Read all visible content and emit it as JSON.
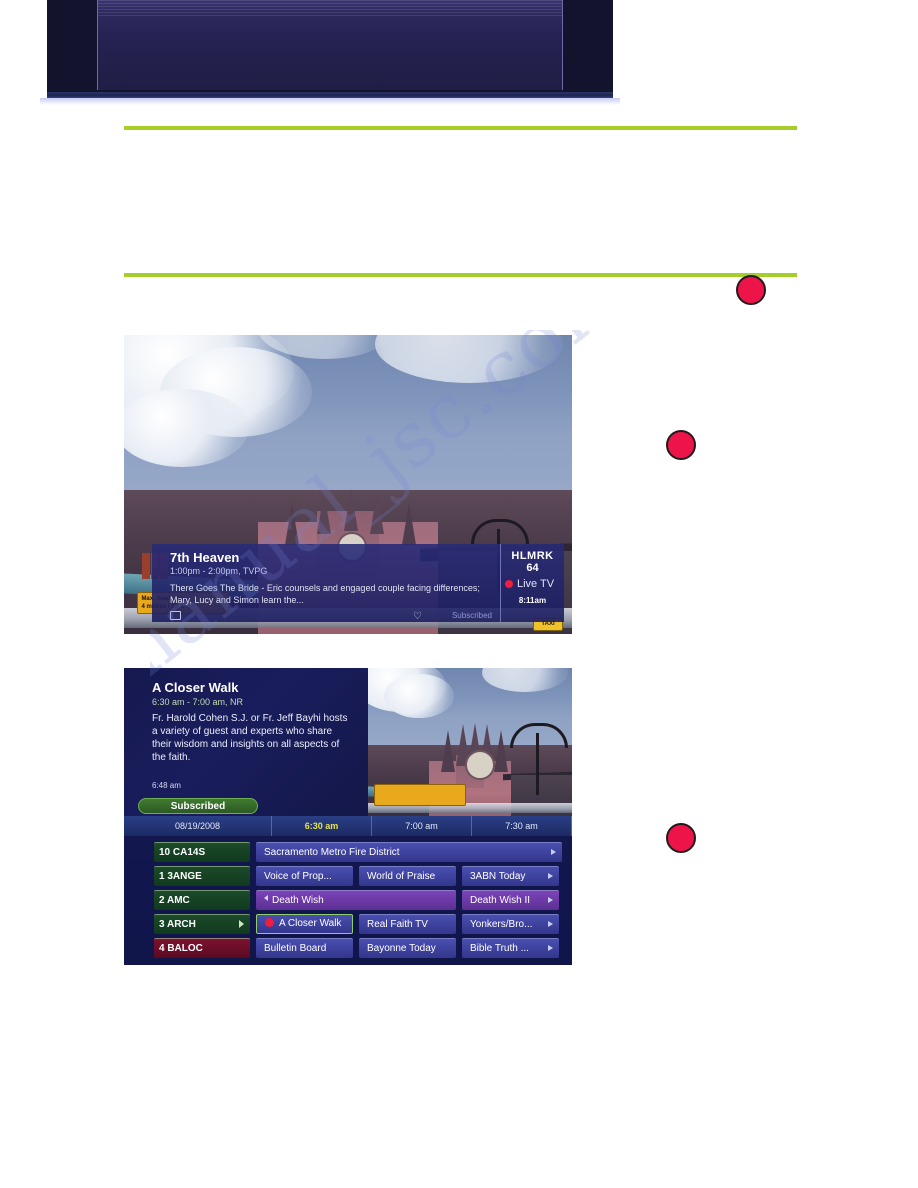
{
  "page": {
    "background_color": "#ffffff",
    "accent_green": "#a5ce2b",
    "marker_color": "#ec1448",
    "watermark_text": "manual_jsc.com"
  },
  "top_banner": {
    "name": "document-header-banner",
    "title": "",
    "background_color": "#14132e"
  },
  "markers": [
    {
      "id": "marker-1",
      "label": ""
    },
    {
      "id": "marker-2",
      "label": ""
    },
    {
      "id": "marker-3",
      "label": ""
    }
  ],
  "figure_one": {
    "name": "live-tv-info-banner-screenshot",
    "photo_alt": "Bristol Temple Meads railway station",
    "photo_signs": {
      "height_sign_line1": "Max. headroom",
      "height_sign_line2": "4 metres / 13' 1\"",
      "taxi_sign": "TAXI"
    },
    "info_bar": {
      "program_title": "7th Heaven",
      "program_time": "1:00pm - 2:00pm, TVPG",
      "description": "There Goes The Bride - Eric counsels and engaged couple facing differences; Mary, Lucy and Simon learn the...",
      "closed_caption_icon": "cc-icon",
      "favorite_icon": "heart-icon",
      "subscribed_label": "Subscribed",
      "channel_callsign": "HLMRK",
      "channel_number": "64",
      "source_label": "Live TV",
      "record_dot_color": "#ef1d3f",
      "clock": "8:11am"
    }
  },
  "figure_two": {
    "name": "guide-grid-screenshot",
    "info_panel": {
      "program_title": "A Closer Walk",
      "program_time": "6:30 am -  7:00 am, NR",
      "description": "Fr. Harold Cohen S.J. or Fr. Jeff Bayhi hosts a variety of guest and experts who share their wisdom and insights on all aspects of the faith.",
      "clock": "6:48 am",
      "subscribed_label": "Subscribed"
    },
    "photo_alt": "Bristol Temple Meads railway station",
    "timeline": {
      "date": "08/19/2008",
      "slots": [
        {
          "label": "6:30 am",
          "current": true
        },
        {
          "label": "7:00 am",
          "current": false
        },
        {
          "label": "7:30 am",
          "current": false
        }
      ]
    },
    "grid_rows": [
      {
        "channel": {
          "number_name": "10 CA14S",
          "color": "green",
          "has_arrow": false
        },
        "programs": [
          {
            "title": "Sacramento Metro Fire District",
            "width": "w-full",
            "style": "blue",
            "arrow": true,
            "selected": false,
            "recording": false,
            "left_arrow": false
          }
        ]
      },
      {
        "channel": {
          "number_name": "1 3ANGE",
          "color": "green",
          "has_arrow": false
        },
        "programs": [
          {
            "title": "Voice of Prop...",
            "width": "w-97",
            "style": "blue",
            "arrow": false,
            "selected": false,
            "recording": false,
            "left_arrow": false
          },
          {
            "title": "World of Praise",
            "width": "w-97",
            "style": "blue",
            "arrow": false,
            "selected": false,
            "recording": false,
            "left_arrow": false
          },
          {
            "title": "3ABN Today",
            "width": "w-97",
            "style": "blue",
            "arrow": true,
            "selected": false,
            "recording": false,
            "left_arrow": false
          }
        ]
      },
      {
        "channel": {
          "number_name": "2 AMC",
          "color": "green",
          "has_arrow": false
        },
        "programs": [
          {
            "title": "Death Wish",
            "width": "w-200",
            "style": "purple",
            "arrow": false,
            "selected": false,
            "recording": false,
            "left_arrow": true
          },
          {
            "title": "Death Wish II",
            "width": "w-97",
            "style": "purple",
            "arrow": true,
            "selected": false,
            "recording": false,
            "left_arrow": false
          }
        ]
      },
      {
        "channel": {
          "number_name": "3 ARCH",
          "color": "green",
          "has_arrow": true
        },
        "programs": [
          {
            "title": "A Closer Walk",
            "width": "w-97",
            "style": "blue",
            "arrow": false,
            "selected": true,
            "recording": true,
            "left_arrow": false
          },
          {
            "title": "Real Faith TV",
            "width": "w-97",
            "style": "blue",
            "arrow": false,
            "selected": false,
            "recording": false,
            "left_arrow": false
          },
          {
            "title": "Yonkers/Bro...",
            "width": "w-97",
            "style": "blue",
            "arrow": true,
            "selected": false,
            "recording": false,
            "left_arrow": false
          }
        ]
      },
      {
        "channel": {
          "number_name": "4 BALOC",
          "color": "red",
          "has_arrow": false
        },
        "programs": [
          {
            "title": "Bulletin Board",
            "width": "w-97",
            "style": "blue",
            "arrow": false,
            "selected": false,
            "recording": false,
            "left_arrow": false
          },
          {
            "title": "Bayonne Today",
            "width": "w-97",
            "style": "blue",
            "arrow": false,
            "selected": false,
            "recording": false,
            "left_arrow": false
          },
          {
            "title": "Bible Truth ...",
            "width": "w-97",
            "style": "blue",
            "arrow": true,
            "selected": false,
            "recording": false,
            "left_arrow": false
          }
        ]
      }
    ]
  }
}
